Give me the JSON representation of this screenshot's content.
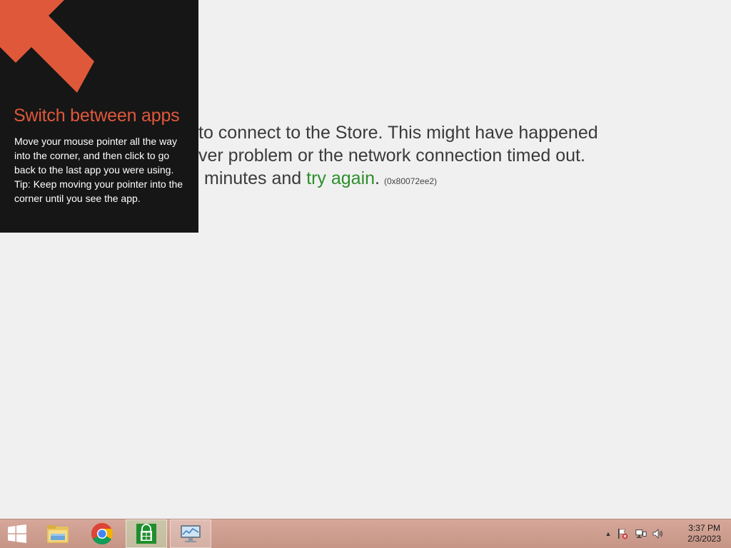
{
  "store_error": {
    "line1": "to connect to the Store. This might have happened",
    "line2": "ver problem or the network connection timed out.",
    "line3_prefix": "minutes and",
    "try_again": "try again",
    "line3_suffix": ".",
    "error_code": "(0x80072ee2)"
  },
  "tip": {
    "title": "Switch between apps",
    "body_line1": "Move your mouse pointer all the way into the corner, and then click to go back to the last app you were using.",
    "body_line2": "Tip: Keep moving your pointer into the corner until you see the app.",
    "accent_color": "#e0583a"
  },
  "taskbar": {
    "apps": [
      {
        "name": "File Explorer",
        "icon": "folder-icon"
      },
      {
        "name": "Google Chrome",
        "icon": "chrome-icon"
      },
      {
        "name": "Store",
        "icon": "store-icon"
      },
      {
        "name": "Remote Desktop",
        "icon": "monitor-icon"
      }
    ],
    "clock_time": "3:37 PM",
    "clock_date": "2/3/2023"
  },
  "colors": {
    "link_green": "#2c8f2c",
    "taskbar": "#c69586",
    "tip_background": "#161616"
  }
}
